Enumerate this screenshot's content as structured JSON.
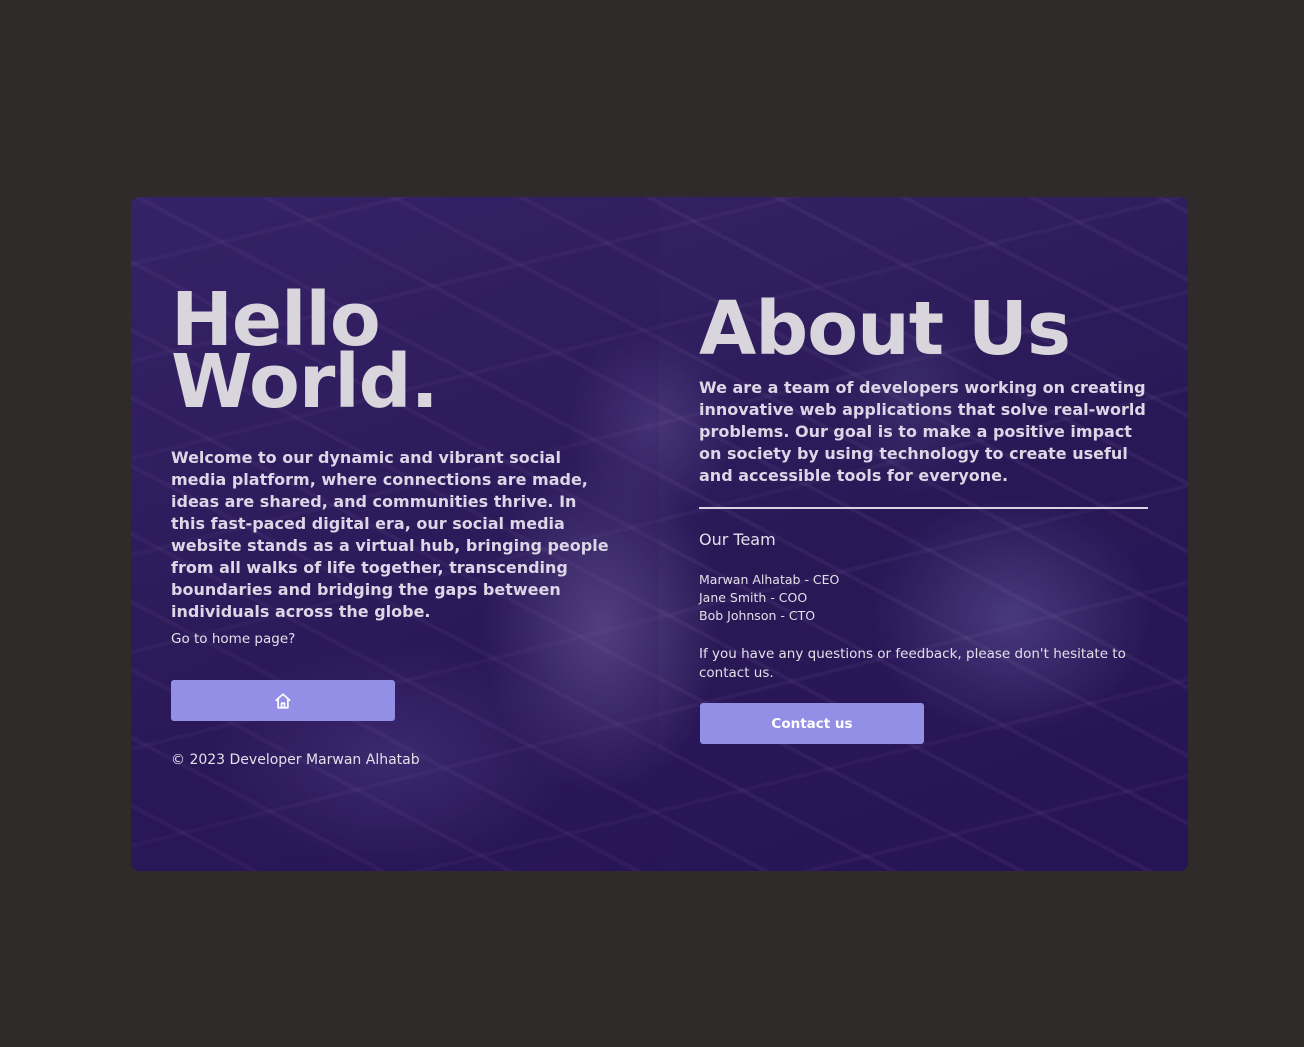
{
  "hero": {
    "title_line1": "Hello",
    "title_line2": "World.",
    "intro": "Welcome to our dynamic and vibrant social media platform, where connections are made, ideas are shared, and communities thrive. In this fast-paced digital era, our social media website stands as a virtual hub, bringing people from all walks of life together, transcending boundaries and bridging the gaps between individuals across the globe.",
    "home_prompt": "Go to home page?",
    "home_button_icon": "home-icon",
    "copyright": "© 2023 Developer Marwan Alhatab"
  },
  "about": {
    "title": "About Us",
    "description": "We are a team of developers working on creating innovative web applications that solve real-world problems. Our goal is to make a positive impact on society by using technology to create useful and accessible tools for everyone.",
    "team_heading": "Our Team",
    "team": [
      "Marwan Alhatab - CEO",
      "Jane Smith - COO",
      "Bob Johnson - CTO"
    ],
    "contact_text": "If you have any questions or feedback, please don't hesitate to contact us.",
    "contact_button": "Contact us"
  },
  "colors": {
    "page_background": "#302b2b",
    "card_overlay": "#2a1a55",
    "button": "#948fe6",
    "heading_text": "#d8d6dc"
  }
}
